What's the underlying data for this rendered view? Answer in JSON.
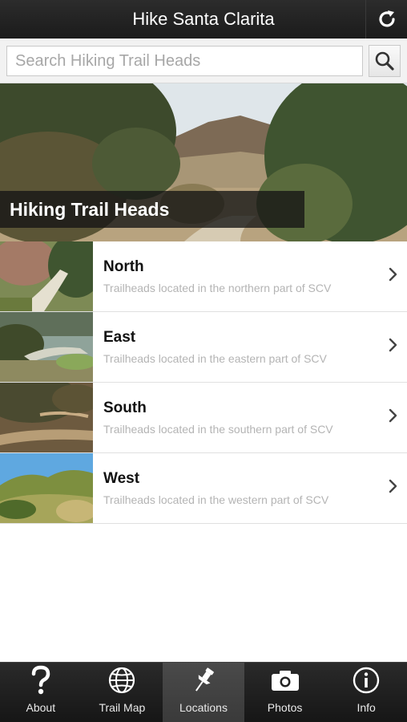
{
  "header": {
    "title": "Hike Santa Clarita",
    "refresh_icon": "refresh-icon"
  },
  "search": {
    "placeholder": "Search Hiking Trail Heads",
    "value": "",
    "button_icon": "search-icon"
  },
  "hero": {
    "caption": "Hiking Trail Heads"
  },
  "regions": [
    {
      "name": "North",
      "description": "Trailheads located in the northern part of SCV"
    },
    {
      "name": "East",
      "description": "Trailheads located in the eastern part of SCV"
    },
    {
      "name": "South",
      "description": "Trailheads located in the southern part of SCV"
    },
    {
      "name": "West",
      "description": "Trailheads located in the western part of SCV"
    }
  ],
  "tabs": [
    {
      "label": "About",
      "icon": "question-icon"
    },
    {
      "label": "Trail Map",
      "icon": "globe-icon"
    },
    {
      "label": "Locations",
      "icon": "pushpin-icon",
      "active": true
    },
    {
      "label": "Photos",
      "icon": "camera-icon"
    },
    {
      "label": "Info",
      "icon": "info-icon"
    }
  ],
  "colors": {
    "topbar": "#1b1b1b",
    "tabbar": "#161616",
    "active_tab": "#3f3f3f",
    "description_text": "#b4b4b4"
  }
}
